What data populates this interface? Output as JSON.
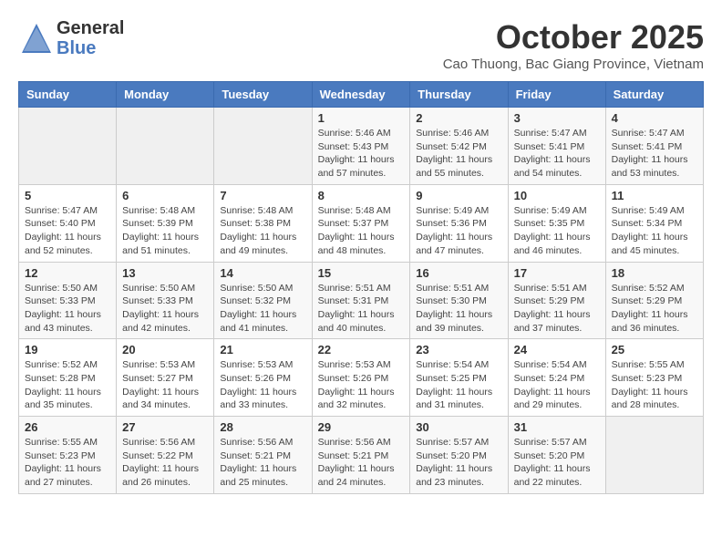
{
  "header": {
    "logo_line1": "General",
    "logo_line2": "Blue",
    "month_title": "October 2025",
    "subtitle": "Cao Thuong, Bac Giang Province, Vietnam"
  },
  "weekdays": [
    "Sunday",
    "Monday",
    "Tuesday",
    "Wednesday",
    "Thursday",
    "Friday",
    "Saturday"
  ],
  "weeks": [
    [
      {
        "day": "",
        "info": ""
      },
      {
        "day": "",
        "info": ""
      },
      {
        "day": "",
        "info": ""
      },
      {
        "day": "1",
        "info": "Sunrise: 5:46 AM\nSunset: 5:43 PM\nDaylight: 11 hours\nand 57 minutes."
      },
      {
        "day": "2",
        "info": "Sunrise: 5:46 AM\nSunset: 5:42 PM\nDaylight: 11 hours\nand 55 minutes."
      },
      {
        "day": "3",
        "info": "Sunrise: 5:47 AM\nSunset: 5:41 PM\nDaylight: 11 hours\nand 54 minutes."
      },
      {
        "day": "4",
        "info": "Sunrise: 5:47 AM\nSunset: 5:41 PM\nDaylight: 11 hours\nand 53 minutes."
      }
    ],
    [
      {
        "day": "5",
        "info": "Sunrise: 5:47 AM\nSunset: 5:40 PM\nDaylight: 11 hours\nand 52 minutes."
      },
      {
        "day": "6",
        "info": "Sunrise: 5:48 AM\nSunset: 5:39 PM\nDaylight: 11 hours\nand 51 minutes."
      },
      {
        "day": "7",
        "info": "Sunrise: 5:48 AM\nSunset: 5:38 PM\nDaylight: 11 hours\nand 49 minutes."
      },
      {
        "day": "8",
        "info": "Sunrise: 5:48 AM\nSunset: 5:37 PM\nDaylight: 11 hours\nand 48 minutes."
      },
      {
        "day": "9",
        "info": "Sunrise: 5:49 AM\nSunset: 5:36 PM\nDaylight: 11 hours\nand 47 minutes."
      },
      {
        "day": "10",
        "info": "Sunrise: 5:49 AM\nSunset: 5:35 PM\nDaylight: 11 hours\nand 46 minutes."
      },
      {
        "day": "11",
        "info": "Sunrise: 5:49 AM\nSunset: 5:34 PM\nDaylight: 11 hours\nand 45 minutes."
      }
    ],
    [
      {
        "day": "12",
        "info": "Sunrise: 5:50 AM\nSunset: 5:33 PM\nDaylight: 11 hours\nand 43 minutes."
      },
      {
        "day": "13",
        "info": "Sunrise: 5:50 AM\nSunset: 5:33 PM\nDaylight: 11 hours\nand 42 minutes."
      },
      {
        "day": "14",
        "info": "Sunrise: 5:50 AM\nSunset: 5:32 PM\nDaylight: 11 hours\nand 41 minutes."
      },
      {
        "day": "15",
        "info": "Sunrise: 5:51 AM\nSunset: 5:31 PM\nDaylight: 11 hours\nand 40 minutes."
      },
      {
        "day": "16",
        "info": "Sunrise: 5:51 AM\nSunset: 5:30 PM\nDaylight: 11 hours\nand 39 minutes."
      },
      {
        "day": "17",
        "info": "Sunrise: 5:51 AM\nSunset: 5:29 PM\nDaylight: 11 hours\nand 37 minutes."
      },
      {
        "day": "18",
        "info": "Sunrise: 5:52 AM\nSunset: 5:29 PM\nDaylight: 11 hours\nand 36 minutes."
      }
    ],
    [
      {
        "day": "19",
        "info": "Sunrise: 5:52 AM\nSunset: 5:28 PM\nDaylight: 11 hours\nand 35 minutes."
      },
      {
        "day": "20",
        "info": "Sunrise: 5:53 AM\nSunset: 5:27 PM\nDaylight: 11 hours\nand 34 minutes."
      },
      {
        "day": "21",
        "info": "Sunrise: 5:53 AM\nSunset: 5:26 PM\nDaylight: 11 hours\nand 33 minutes."
      },
      {
        "day": "22",
        "info": "Sunrise: 5:53 AM\nSunset: 5:26 PM\nDaylight: 11 hours\nand 32 minutes."
      },
      {
        "day": "23",
        "info": "Sunrise: 5:54 AM\nSunset: 5:25 PM\nDaylight: 11 hours\nand 31 minutes."
      },
      {
        "day": "24",
        "info": "Sunrise: 5:54 AM\nSunset: 5:24 PM\nDaylight: 11 hours\nand 29 minutes."
      },
      {
        "day": "25",
        "info": "Sunrise: 5:55 AM\nSunset: 5:23 PM\nDaylight: 11 hours\nand 28 minutes."
      }
    ],
    [
      {
        "day": "26",
        "info": "Sunrise: 5:55 AM\nSunset: 5:23 PM\nDaylight: 11 hours\nand 27 minutes."
      },
      {
        "day": "27",
        "info": "Sunrise: 5:56 AM\nSunset: 5:22 PM\nDaylight: 11 hours\nand 26 minutes."
      },
      {
        "day": "28",
        "info": "Sunrise: 5:56 AM\nSunset: 5:21 PM\nDaylight: 11 hours\nand 25 minutes."
      },
      {
        "day": "29",
        "info": "Sunrise: 5:56 AM\nSunset: 5:21 PM\nDaylight: 11 hours\nand 24 minutes."
      },
      {
        "day": "30",
        "info": "Sunrise: 5:57 AM\nSunset: 5:20 PM\nDaylight: 11 hours\nand 23 minutes."
      },
      {
        "day": "31",
        "info": "Sunrise: 5:57 AM\nSunset: 5:20 PM\nDaylight: 11 hours\nand 22 minutes."
      },
      {
        "day": "",
        "info": ""
      }
    ]
  ]
}
